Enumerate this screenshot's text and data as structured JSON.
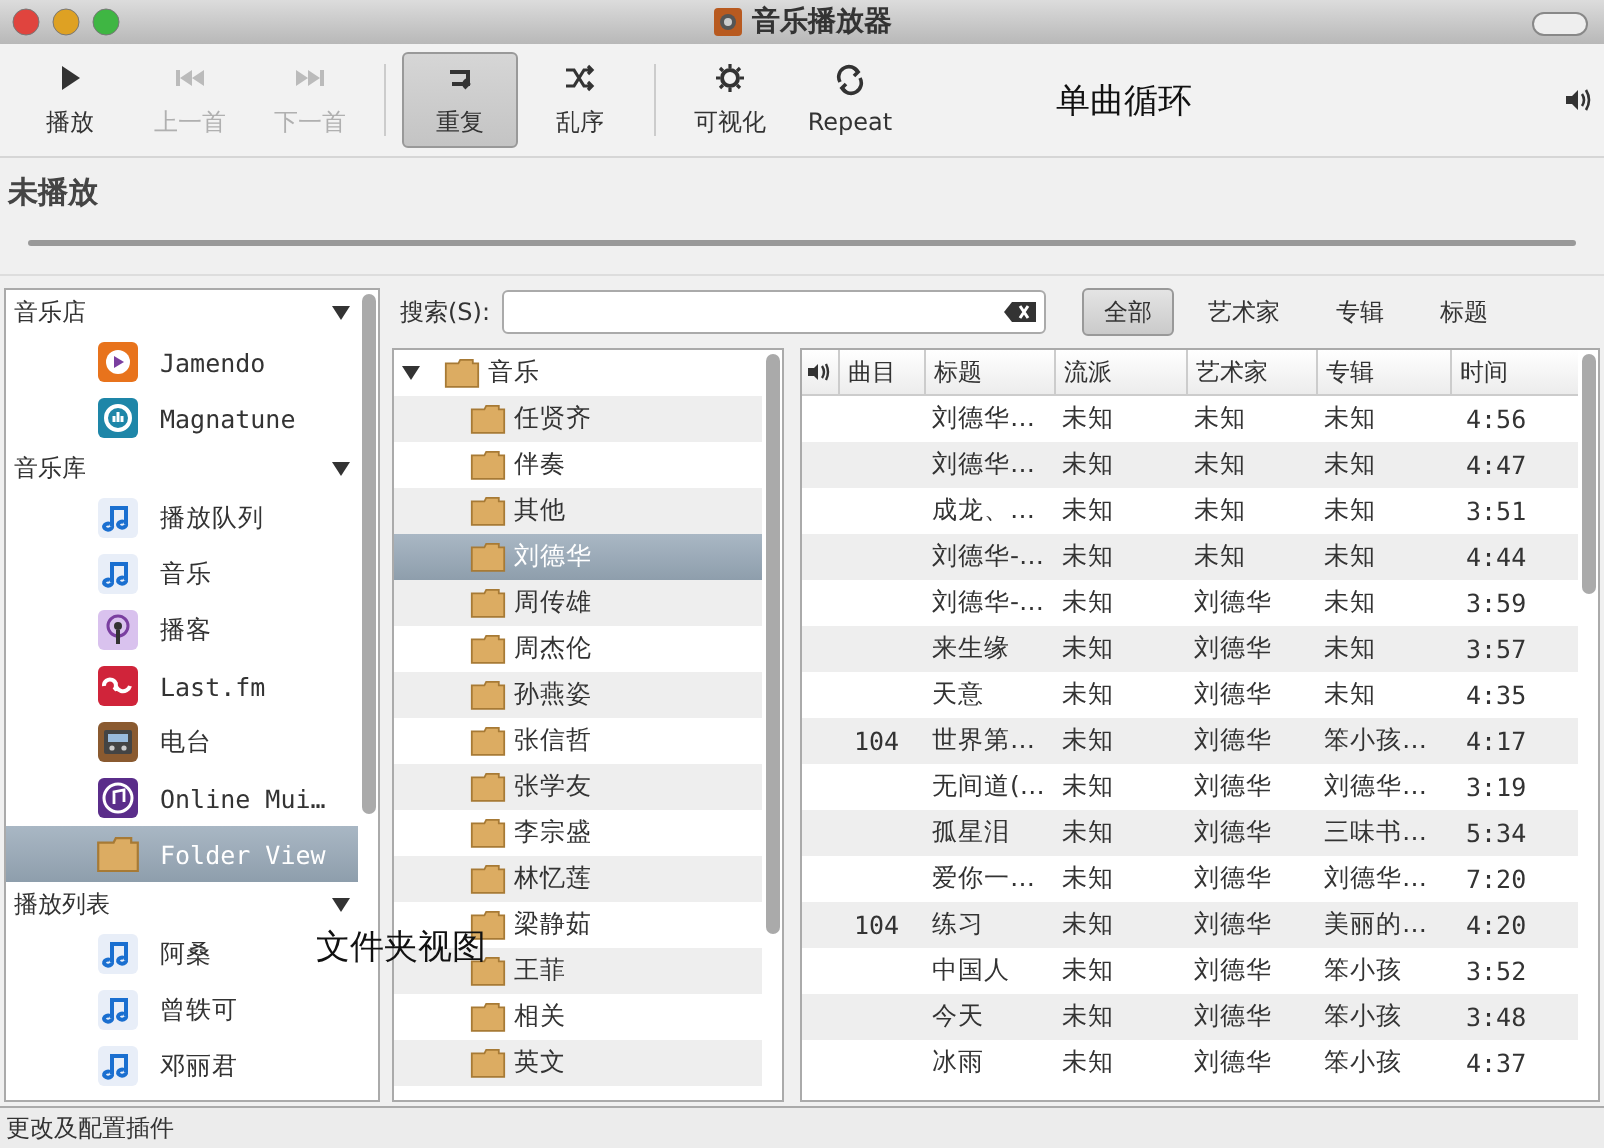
{
  "window": {
    "title": "音乐播放器"
  },
  "toolbar": [
    {
      "label": "播放",
      "kind": "play",
      "disabled": false,
      "selected": false
    },
    {
      "label": "上一首",
      "kind": "prev",
      "disabled": true,
      "selected": false
    },
    {
      "label": "下一首",
      "kind": "next",
      "disabled": true,
      "selected": false
    },
    {
      "label": "重复",
      "kind": "repeat",
      "disabled": false,
      "selected": true
    },
    {
      "label": "乱序",
      "kind": "shuffle",
      "disabled": false,
      "selected": false
    },
    {
      "label": "可视化",
      "kind": "visual",
      "disabled": false,
      "selected": false
    },
    {
      "label": "Repeat",
      "kind": "repeatone",
      "disabled": false,
      "selected": false
    }
  ],
  "annotations": [
    "单曲循环",
    "文件夹视图"
  ],
  "now_playing": {
    "text": "未播放"
  },
  "sidebar": {
    "sections": [
      {
        "title": "音乐店",
        "expanded": true,
        "items": [
          {
            "label": "Jamendo",
            "kind": "jamendo",
            "selected": false
          },
          {
            "label": "Magnatune",
            "kind": "magnatune",
            "selected": false
          }
        ]
      },
      {
        "title": "音乐库",
        "expanded": true,
        "items": [
          {
            "label": "播放队列",
            "kind": "note",
            "selected": false
          },
          {
            "label": "音乐",
            "kind": "note",
            "selected": false
          },
          {
            "label": "播客",
            "kind": "podcast",
            "selected": false
          },
          {
            "label": "Last.fm",
            "kind": "lastfm",
            "selected": false
          },
          {
            "label": "电台",
            "kind": "radio",
            "selected": false
          },
          {
            "label": "Online Mui…",
            "kind": "online",
            "selected": false
          },
          {
            "label": "Folder View",
            "kind": "folder",
            "selected": true
          }
        ]
      },
      {
        "title": "播放列表",
        "expanded": true,
        "items": [
          {
            "label": "阿桑",
            "kind": "note",
            "selected": false
          },
          {
            "label": "曾轶可",
            "kind": "note",
            "selected": false
          },
          {
            "label": "邓丽君",
            "kind": "note",
            "selected": false
          }
        ]
      }
    ]
  },
  "search": {
    "label": "搜索(S):"
  },
  "filter_tabs": [
    {
      "label": "全部",
      "selected": true
    },
    {
      "label": "艺术家",
      "selected": false
    },
    {
      "label": "专辑",
      "selected": false
    },
    {
      "label": "标题",
      "selected": false
    }
  ],
  "folder_tree": [
    {
      "label": "音乐",
      "expanded": true,
      "selected": false,
      "children": [
        {
          "label": "任贤齐",
          "selected": false
        },
        {
          "label": "伴奏",
          "selected": false
        },
        {
          "label": "其他",
          "selected": false
        },
        {
          "label": "刘德华",
          "selected": true
        },
        {
          "label": "周传雄",
          "selected": false
        },
        {
          "label": "周杰伦",
          "selected": false
        },
        {
          "label": "孙燕姿",
          "selected": false
        },
        {
          "label": "张信哲",
          "selected": false
        },
        {
          "label": "张学友",
          "selected": false
        },
        {
          "label": "李宗盛",
          "selected": false
        },
        {
          "label": "林忆莲",
          "selected": false
        },
        {
          "label": "梁静茹",
          "selected": false
        },
        {
          "label": "王菲",
          "selected": false
        },
        {
          "label": "相关",
          "selected": false
        },
        {
          "label": "英文",
          "selected": false
        }
      ]
    }
  ],
  "table": {
    "columns": [
      "曲目",
      "标题",
      "流派",
      "艺术家",
      "专辑",
      "时间"
    ],
    "rows": [
      [
        "",
        "刘德华…",
        "未知",
        "未知",
        "未知",
        "4:56"
      ],
      [
        "",
        "刘德华…",
        "未知",
        "未知",
        "未知",
        "4:47"
      ],
      [
        "",
        "成龙、…",
        "未知",
        "未知",
        "未知",
        "3:51"
      ],
      [
        "",
        "刘德华-…",
        "未知",
        "未知",
        "未知",
        "4:44"
      ],
      [
        "",
        "刘德华-…",
        "未知",
        "刘德华",
        "未知",
        "3:59"
      ],
      [
        "",
        "来生缘",
        "未知",
        "刘德华",
        "未知",
        "3:57"
      ],
      [
        "",
        "天意",
        "未知",
        "刘德华",
        "未知",
        "4:35"
      ],
      [
        "104",
        "世界第…",
        "未知",
        "刘德华",
        "笨小孩…",
        "4:17"
      ],
      [
        "",
        "无间道(…",
        "未知",
        "刘德华",
        "刘德华…",
        "3:19"
      ],
      [
        "",
        "孤星泪",
        "未知",
        "刘德华",
        "三味书…",
        "5:34"
      ],
      [
        "",
        "爱你一…",
        "未知",
        "刘德华",
        "刘德华…",
        "7:20"
      ],
      [
        "104",
        "练习",
        "未知",
        "刘德华",
        "美丽的…",
        "4:20"
      ],
      [
        "",
        "中国人",
        "未知",
        "刘德华",
        "笨小孩",
        "3:52"
      ],
      [
        "",
        "今天",
        "未知",
        "刘德华",
        "笨小孩",
        "3:48"
      ],
      [
        "",
        "冰雨",
        "未知",
        "刘德华",
        "笨小孩",
        "4:37"
      ]
    ]
  },
  "status_bar": {
    "text": "更改及配置插件"
  }
}
